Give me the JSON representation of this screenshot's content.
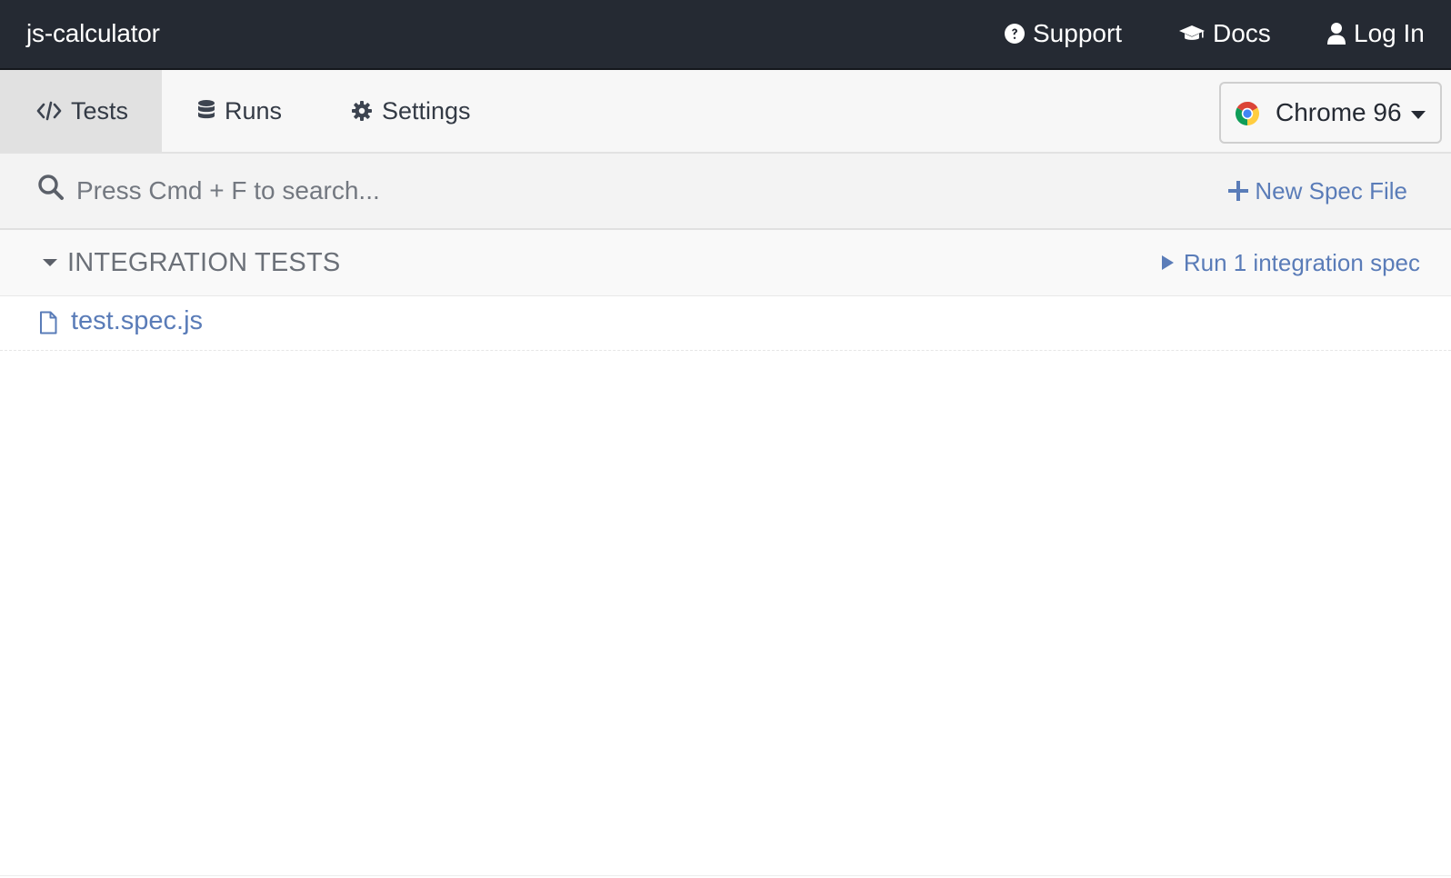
{
  "header": {
    "app_title": "js-calculator",
    "links": {
      "support": "Support",
      "docs": "Docs",
      "login": "Log In"
    }
  },
  "nav": {
    "tabs": {
      "tests": "Tests",
      "runs": "Runs",
      "settings": "Settings"
    },
    "active_tab": "tests",
    "browser": {
      "label": "Chrome 96",
      "icon": "chrome-icon"
    }
  },
  "search": {
    "placeholder": "Press Cmd + F to search...",
    "value": "",
    "new_spec_label": "New Spec File"
  },
  "specs": {
    "section_title": "INTEGRATION TESTS",
    "run_all_label": "Run 1 integration spec",
    "files": [
      {
        "name": "test.spec.js"
      }
    ]
  },
  "colors": {
    "topbar_bg": "#252a33",
    "link_blue": "#5a7cb8",
    "active_tab_bg": "#e1e1e1"
  }
}
